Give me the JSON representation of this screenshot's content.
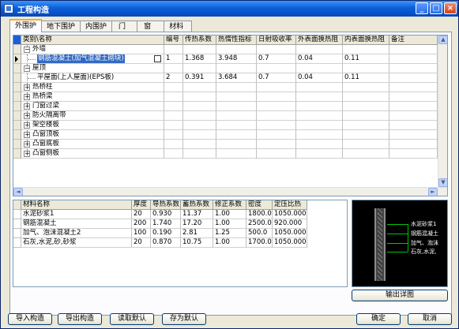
{
  "window": {
    "title": "工程构造",
    "minimize": "_",
    "maximize": "□",
    "close": "×"
  },
  "tabs": [
    "外围护",
    "地下围护",
    "内围护",
    "门",
    "窗",
    "材料"
  ],
  "top_grid": {
    "columns": [
      "类别\\名称",
      "编号",
      "传热系数",
      "热惰性指标",
      "日射吸收率",
      "外表面换热阻",
      "内表面换热阻",
      "备注"
    ],
    "rows": [
      {
        "kind": "group",
        "expander": "−",
        "name": "外墙"
      },
      {
        "kind": "item",
        "name": "钢筋混凝土(加气混凝土砌块)",
        "num": "1",
        "k": "1.368",
        "d": "3.948",
        "rho": "0.7",
        "re": "0.04",
        "ri": "0.11"
      },
      {
        "kind": "group",
        "expander": "−",
        "name": "屋顶"
      },
      {
        "kind": "item",
        "name": "平屋面(上人屋面)(EPS板)",
        "num": "2",
        "k": "0.391",
        "d": "3.684",
        "rho": "0.7",
        "re": "0.04",
        "ri": "0.11"
      },
      {
        "kind": "group",
        "expander": "+",
        "name": "热桥柱"
      },
      {
        "kind": "group",
        "expander": "+",
        "name": "热桥梁"
      },
      {
        "kind": "group",
        "expander": "+",
        "name": "门窗过梁"
      },
      {
        "kind": "group",
        "expander": "+",
        "name": "防火隔离带"
      },
      {
        "kind": "group",
        "expander": "+",
        "name": "架空楼板"
      },
      {
        "kind": "group",
        "expander": "+",
        "name": "凸窗顶板"
      },
      {
        "kind": "group",
        "expander": "+",
        "name": "凸窗底板"
      },
      {
        "kind": "group",
        "expander": "+",
        "name": "凸窗侧板"
      }
    ]
  },
  "materials": {
    "columns": [
      "材料名称",
      "厚度",
      "导热系数",
      "蓄热系数",
      "修正系数",
      "密度",
      "定压比热"
    ],
    "rows": [
      [
        "水泥砂浆1",
        "20",
        "0.930",
        "11.37",
        "1.00",
        "1800.0",
        "1050.000"
      ],
      [
        "钢筋混凝土",
        "200",
        "1.740",
        "17.20",
        "1.00",
        "2500.0",
        "920.000"
      ],
      [
        "加气、泡沫混凝土2",
        "100",
        "0.190",
        "2.81",
        "1.25",
        "500.0",
        "1050.000"
      ],
      [
        "石灰,水泥,砂,砂浆",
        "20",
        "0.870",
        "10.75",
        "1.00",
        "1700.0",
        "1050.000"
      ]
    ]
  },
  "preview": {
    "labels": [
      "水泥砂浆1",
      "钢筋混凝土",
      "加气、泡沫",
      "石灰,水泥,"
    ]
  },
  "buttons": {
    "detail": "输出详图",
    "import": "导入构造",
    "export": "导出构造",
    "read_default": "读取默认",
    "save_default": "存为默认",
    "ok": "确定",
    "cancel": "取消"
  },
  "scroll": {
    "left": "◄",
    "right": "►",
    "up": "▲",
    "down": "▼"
  }
}
